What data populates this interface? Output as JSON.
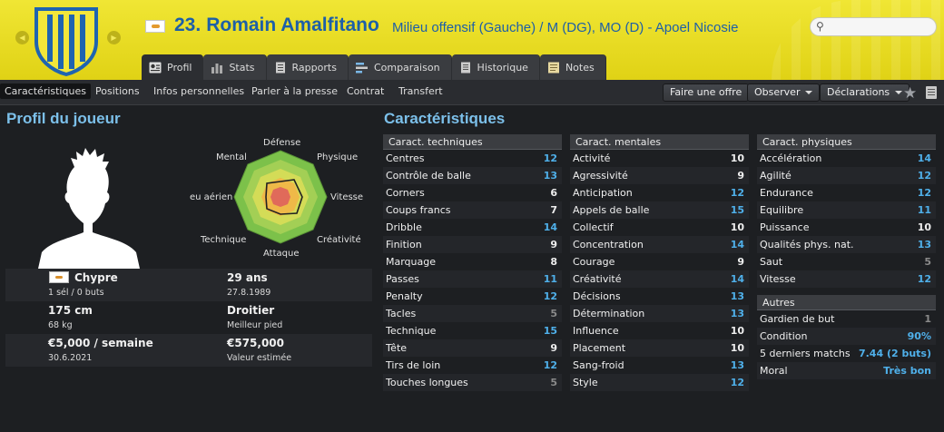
{
  "header": {
    "number": "23.",
    "name": "Romain Amalfitano",
    "subtitle": "Milieu offensif (Gauche) / M (DG), MO (D) - Apoel Nicosie",
    "search_placeholder": "",
    "accent_color": "#e8dc1f",
    "title_color": "#1d5fa8"
  },
  "tabs": [
    {
      "label": "Profil",
      "icon": "profile-icon",
      "active": true
    },
    {
      "label": "Stats",
      "icon": "stats-icon"
    },
    {
      "label": "Rapports",
      "icon": "reports-icon"
    },
    {
      "label": "Comparaison",
      "icon": "compare-icon"
    },
    {
      "label": "Historique",
      "icon": "history-icon"
    },
    {
      "label": "Notes",
      "icon": "notes-icon"
    }
  ],
  "subnav": {
    "items": [
      "Caractéristiques",
      "Positions",
      "Infos personnelles",
      "Parler à la presse",
      "Contrat",
      "Transfert"
    ],
    "buttons": {
      "offer": "Faire une offre",
      "observe": "Observer",
      "declarations": "Déclarations"
    }
  },
  "profile": {
    "title": "Profil du joueur",
    "radar_labels": {
      "top": "Défense",
      "top_right": "Physique",
      "right": "Vitesse",
      "bottom_right": "Créativité",
      "bottom": "Attaque",
      "bottom_left": "Technique",
      "left": "eu aérien",
      "top_left": "Mental"
    },
    "nationality": "Chypre",
    "caps": "1 sél / 0 buts",
    "age": "29 ans",
    "birthdate": "27.8.1989",
    "height": "175 cm",
    "weight": "68 kg",
    "foot": "Droitier",
    "foot_label": "Meilleur pied",
    "wage": "€5,000 / semaine",
    "contract_end": "30.6.2021",
    "value": "€575,000",
    "value_label": "Valeur estimée"
  },
  "attributes": {
    "title": "Caractéristiques",
    "technical": {
      "header": "Caract. techniques",
      "items": [
        {
          "name": "Centres",
          "value": "12"
        },
        {
          "name": "Contrôle de balle",
          "value": "13"
        },
        {
          "name": "Corners",
          "value": "6"
        },
        {
          "name": "Coups francs",
          "value": "7"
        },
        {
          "name": "Dribble",
          "value": "14"
        },
        {
          "name": "Finition",
          "value": "9"
        },
        {
          "name": "Marquage",
          "value": "8"
        },
        {
          "name": "Passes",
          "value": "11"
        },
        {
          "name": "Penalty",
          "value": "12"
        },
        {
          "name": "Tacles",
          "value": "5"
        },
        {
          "name": "Technique",
          "value": "15"
        },
        {
          "name": "Tête",
          "value": "9"
        },
        {
          "name": "Tirs de loin",
          "value": "12"
        },
        {
          "name": "Touches longues",
          "value": "5"
        }
      ]
    },
    "mental": {
      "header": "Caract. mentales",
      "items": [
        {
          "name": "Activité",
          "value": "10"
        },
        {
          "name": "Agressivité",
          "value": "9"
        },
        {
          "name": "Anticipation",
          "value": "12"
        },
        {
          "name": "Appels de balle",
          "value": "15"
        },
        {
          "name": "Collectif",
          "value": "10"
        },
        {
          "name": "Concentration",
          "value": "14"
        },
        {
          "name": "Courage",
          "value": "9"
        },
        {
          "name": "Créativité",
          "value": "14"
        },
        {
          "name": "Décisions",
          "value": "13"
        },
        {
          "name": "Détermination",
          "value": "13"
        },
        {
          "name": "Influence",
          "value": "10"
        },
        {
          "name": "Placement",
          "value": "10"
        },
        {
          "name": "Sang-froid",
          "value": "13"
        },
        {
          "name": "Style",
          "value": "12"
        }
      ]
    },
    "physical": {
      "header": "Caract. physiques",
      "items": [
        {
          "name": "Accélération",
          "value": "14"
        },
        {
          "name": "Agilité",
          "value": "12"
        },
        {
          "name": "Endurance",
          "value": "12"
        },
        {
          "name": "Equilibre",
          "value": "11"
        },
        {
          "name": "Puissance",
          "value": "10"
        },
        {
          "name": "Qualités phys. nat.",
          "value": "13"
        },
        {
          "name": "Saut",
          "value": "5"
        },
        {
          "name": "Vitesse",
          "value": "12"
        }
      ]
    },
    "other": {
      "header": "Autres",
      "items": [
        {
          "name": "Gardien de but",
          "value": "1"
        },
        {
          "name": "Condition",
          "value": "90%"
        },
        {
          "name": "5 derniers matchs",
          "value": "7.44 (2 buts)"
        },
        {
          "name": "Moral",
          "value": "Très bon"
        }
      ]
    }
  }
}
